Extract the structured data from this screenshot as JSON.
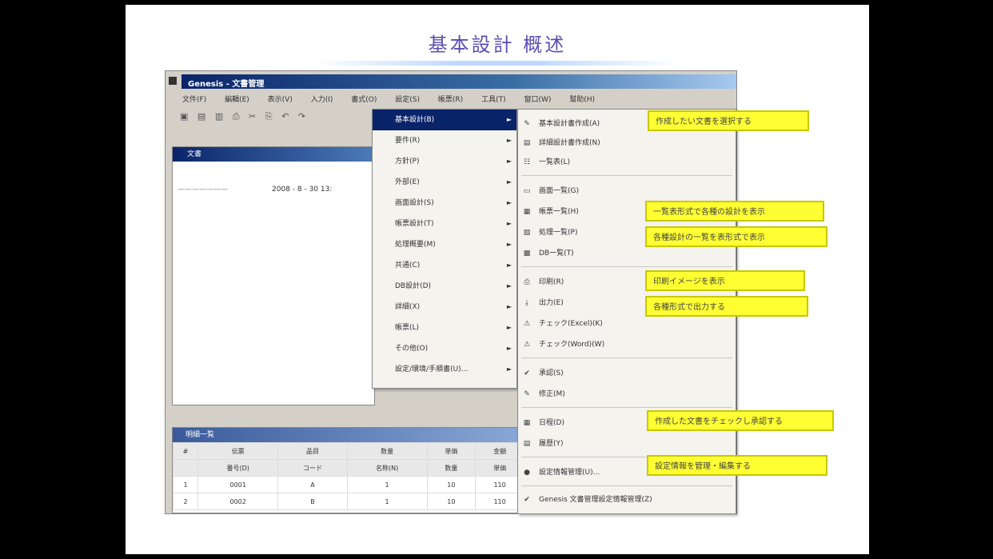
{
  "slide": {
    "title": "基本設計 概述"
  },
  "window": {
    "title": "Genesis - 文書管理",
    "menus": [
      "文件(F)",
      "編輯(E)",
      "表示(V)",
      "入力(I)",
      "書式(O)",
      "設定(S)",
      "帳票(R)",
      "工具(T)",
      "窗口(W)",
      "幫助(H)"
    ],
    "toolbar": [
      "▣",
      "▤",
      "▥",
      "⎙",
      "✂",
      "⎘",
      "↶",
      "↷"
    ],
    "doc_title": "文書",
    "doc_line_left": "———————",
    "doc_line_right": "2008 - 8 - 30  13:",
    "grid_title": "明細一覧",
    "grid_head1": [
      "#",
      "伝票",
      "品目",
      "数量",
      "単価",
      "金額"
    ],
    "grid_head2": [
      "",
      "番号(D)",
      "コード",
      "名称(N)",
      "数量",
      "単価"
    ],
    "grid_rows": [
      [
        "1",
        "0001",
        "A",
        "1",
        "10",
        "110"
      ],
      [
        "2",
        "0002",
        "B",
        "1",
        "10",
        "110"
      ]
    ]
  },
  "menu1": {
    "items": [
      {
        "label": "基本設計(B)",
        "selected": true
      },
      {
        "label": "要件(R)"
      },
      {
        "label": "方針(P)"
      },
      {
        "label": "外部(E)"
      },
      {
        "label": "画面設計(S)"
      },
      {
        "label": "帳票設計(T)"
      },
      {
        "label": "処理概要(M)"
      },
      {
        "label": "共通(C)"
      },
      {
        "label": "DB設計(D)"
      },
      {
        "label": "詳細(X)"
      },
      {
        "label": "帳票(L)"
      },
      {
        "label": "その他(O)"
      },
      {
        "label": "設定/環境/手順書(U)..."
      }
    ]
  },
  "menu2": {
    "items": [
      {
        "icon": "doc-edit-icon",
        "glyph": "✎",
        "label": "基本設計書作成(A)"
      },
      {
        "icon": "doc-new-icon",
        "glyph": "▤",
        "label": "詳細設計書作成(N)"
      },
      {
        "icon": "list-icon",
        "glyph": "☷",
        "label": "一覧表(L)"
      },
      {
        "icon": "screen-icon",
        "glyph": "▭",
        "label": "画面一覧(G)"
      },
      {
        "icon": "form-icon",
        "glyph": "▦",
        "label": "帳票一覧(H)"
      },
      {
        "icon": "process-icon",
        "glyph": "▧",
        "label": "処理一覧(P)"
      },
      {
        "icon": "table-icon",
        "glyph": "▩",
        "label": "DB一覧(T)"
      },
      {
        "icon": "print-icon",
        "glyph": "⎙",
        "label": "印刷(R)"
      },
      {
        "icon": "export-icon",
        "glyph": "⤓",
        "label": "出力(E)"
      },
      {
        "icon": "warning-icon",
        "glyph": "⚠",
        "label": "チェック(Excel)(K)"
      },
      {
        "icon": "warning2-icon",
        "glyph": "⚠",
        "label": "チェック(Word)(W)"
      },
      {
        "icon": "check-icon",
        "glyph": "✔",
        "label": "承認(S)"
      },
      {
        "icon": "edit-icon",
        "glyph": "✎",
        "label": "修正(M)"
      },
      {
        "icon": "calendar-icon",
        "glyph": "▦",
        "label": "日程(D)"
      },
      {
        "icon": "history-icon",
        "glyph": "▤",
        "label": "履歴(Y)"
      },
      {
        "icon": "user-icon",
        "glyph": "●",
        "label": "設定情報管理(U)..."
      },
      {
        "icon": "shield-icon",
        "glyph": "✔",
        "label": "Genesis 文書管理設定情報管理(Z)"
      }
    ]
  },
  "callouts": [
    "作成したい文書を選択する",
    "一覧表形式で各種の設計を表示",
    "各種設計の一覧を表形式で表示",
    "印刷イメージを表示",
    "各種形式で出力する",
    "作成した文書をチェックし承認する",
    "設定情報を管理・編集する"
  ],
  "colors": {
    "callout": "#ffff33",
    "titlebar": "#0a246a",
    "slide_title": "#5a4fb0"
  }
}
